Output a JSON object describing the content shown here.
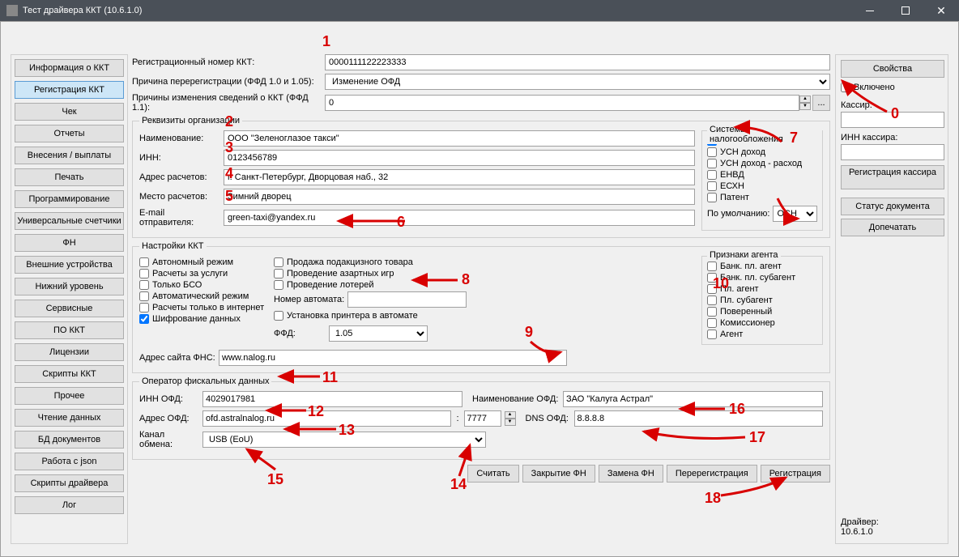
{
  "window": {
    "title": "Тест драйвера ККТ (10.6.1.0)"
  },
  "sidebar": [
    "Информация о ККТ",
    "Регистрация ККТ",
    "Чек",
    "Отчеты",
    "Внесения / выплаты",
    "Печать",
    "Программирование",
    "Универсальные счетчики",
    "ФН",
    "Внешние устройства",
    "Нижний уровень",
    "Сервисные",
    "ПО ККТ",
    "Лицензии",
    "Скрипты ККТ",
    "Прочее",
    "Чтение данных",
    "БД документов",
    "Работа с json",
    "Скрипты драйвера",
    "Лог"
  ],
  "sidebar_active_index": 1,
  "top": {
    "reg_label": "Регистрационный номер ККТ:",
    "reg_value": "0000111122223333",
    "rereg_label": "Причина перерегистрации (ФФД 1.0 и 1.05):",
    "rereg_value": "Изменение ОФД",
    "reasons_label": "Причины изменения сведений о ККТ (ФФД 1.1):",
    "reasons_value": "0",
    "ellipsis": "..."
  },
  "org": {
    "legend": "Реквизиты организации",
    "name_label": "Наименование:",
    "name_value": "ООО \"Зеленоглазое такси\"",
    "inn_label": "ИНН:",
    "inn_value": "0123456789",
    "addr_label": "Адрес расчетов:",
    "addr_value": "г. Санкт-Петербург, Дворцовая наб., 32",
    "place_label": "Место расчетов:",
    "place_value": "Зимний дворец",
    "email_label": "E-mail отправителя:",
    "email_value": "green-taxi@yandex.ru"
  },
  "tax": {
    "title": "Системы налогообложения",
    "items": [
      "ОСН",
      "УСН доход",
      "УСН доход - расход",
      "ЕНВД",
      "ЕСХН",
      "Патент"
    ],
    "checked": [
      true,
      false,
      false,
      false,
      false,
      false
    ],
    "default_label": "По умолчанию:",
    "default_value": "ОСН"
  },
  "kkt": {
    "legend": "Настройки ККТ",
    "col1": [
      "Автономный режим",
      "Расчеты за услуги",
      "Только БСО",
      "Автоматический режим",
      "Расчеты только в интернет",
      "Шифрование данных"
    ],
    "col1_checked": [
      false,
      false,
      false,
      false,
      false,
      true
    ],
    "col2": [
      "Продажа подакцизного товара",
      "Проведение азартных игр",
      "Проведение лотерей"
    ],
    "num_label": "Номер автомата:",
    "printer_label": "Установка принтера в автомате",
    "ffd_label": "ФФД:",
    "ffd_value": "1.05",
    "fns_label": "Адрес сайта ФНС:",
    "fns_value": "www.nalog.ru"
  },
  "agents": {
    "title": "Признаки агента",
    "items": [
      "Банк. пл. агент",
      "Банк. пл. субагент",
      "Пл. агент",
      "Пл. субагент",
      "Поверенный",
      "Комиссионер",
      "Агент"
    ]
  },
  "ofd": {
    "legend": "Оператор фискальных данных",
    "inn_label": "ИНН ОФД:",
    "inn_value": "4029017981",
    "name_label": "Наименование ОФД:",
    "name_value": "ЗАО \"Калуга Астрал\"",
    "addr_label": "Адрес ОФД:",
    "addr_value": "ofd.astralnalog.ru",
    "port_value": "7777",
    "dns_label": "DNS ОФД:",
    "dns_value": "8.8.8.8",
    "channel_label": "Канал обмена:",
    "channel_value": "USB (EoU)"
  },
  "actions": [
    "Считать",
    "Закрытие ФН",
    "Замена ФН",
    "Перерегистрация",
    "Регистрация"
  ],
  "right": {
    "props": "Свойства",
    "enabled": "Включено",
    "cashier_label": "Кассир:",
    "cashier_inn_label": "ИНН кассира:",
    "reg_cashier": "Регистрация кассира",
    "doc_status": "Статус документа",
    "reprint": "Допечатать",
    "driver_label": "Драйвер:",
    "driver_ver": "10.6.1.0"
  },
  "anno": [
    "0",
    "1",
    "2",
    "3",
    "4",
    "5",
    "6",
    "7",
    "8",
    "9",
    "10",
    "11",
    "12",
    "13",
    "14",
    "15",
    "16",
    "17",
    "18"
  ]
}
